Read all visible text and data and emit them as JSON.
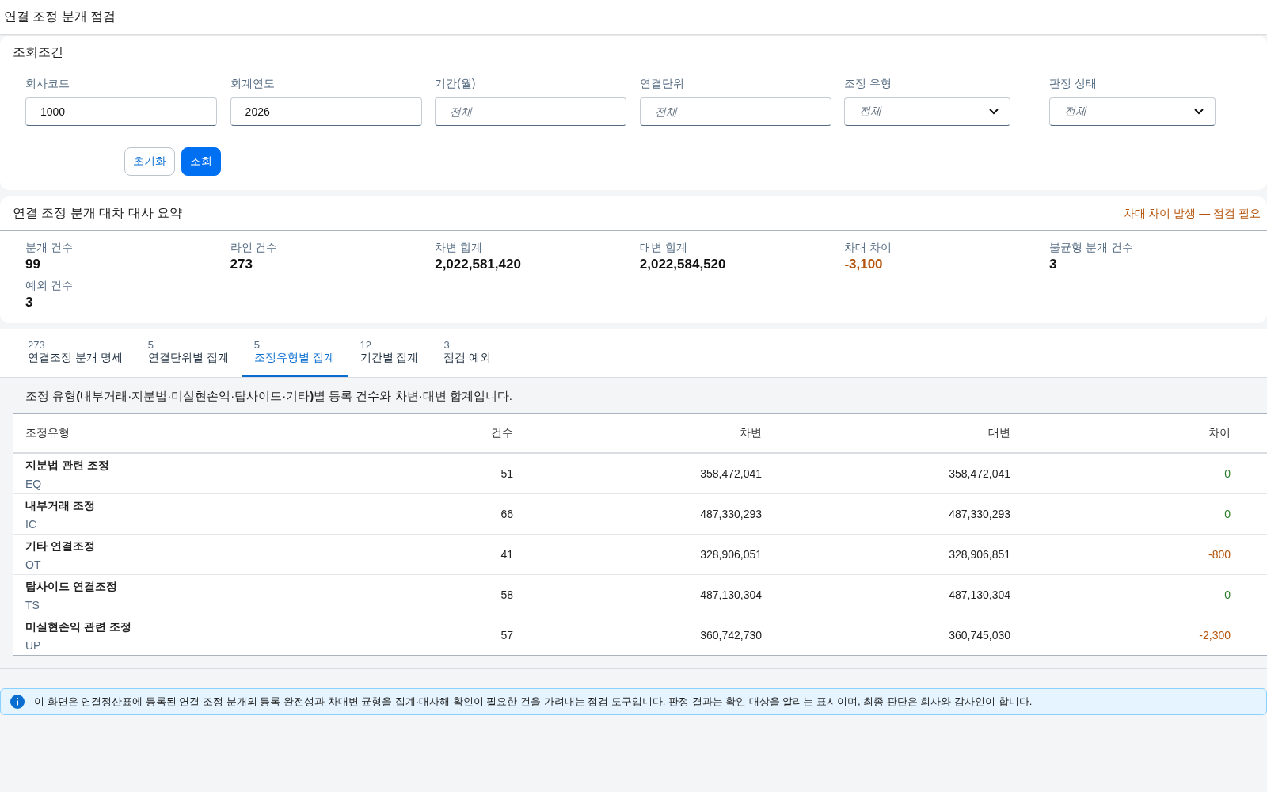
{
  "page_title": "연결 조정 분개 점검",
  "filter": {
    "title": "조회조건",
    "fields": [
      {
        "label": "회사코드",
        "kind": "text",
        "value": "1000"
      },
      {
        "label": "회계연도",
        "kind": "text",
        "value": "2026"
      },
      {
        "label": "기간(월)",
        "kind": "text",
        "placeholder": "전체"
      },
      {
        "label": "연결단위",
        "kind": "text",
        "placeholder": "전체"
      },
      {
        "label": "조정 유형",
        "kind": "select",
        "placeholder": "전체"
      },
      {
        "label": "판정 상태",
        "kind": "select",
        "placeholder": "전체"
      }
    ],
    "buttons": [
      {
        "label": "초기화",
        "kind": "secondary"
      },
      {
        "label": "조회",
        "kind": "primary"
      }
    ]
  },
  "summary": {
    "title": "연결 조정 분개 대차 대사 요약",
    "alert": "차대 차이 발생 — 점검 필요",
    "metrics": [
      {
        "label": "분개 건수",
        "value": "99",
        "warn": false
      },
      {
        "label": "라인 건수",
        "value": "273",
        "warn": false
      },
      {
        "label": "차변 합계",
        "value": "2,022,581,420",
        "warn": false
      },
      {
        "label": "대변 합계",
        "value": "2,022,584,520",
        "warn": false
      },
      {
        "label": "차대 차이",
        "value": "-3,100",
        "warn": true
      },
      {
        "label": "불균형 분개 건수",
        "value": "3",
        "warn": false
      },
      {
        "label": "예외 건수",
        "value": "3",
        "warn": false
      }
    ]
  },
  "tabs": [
    {
      "count": "273",
      "label": "연결조정 분개 명세",
      "selected": false
    },
    {
      "count": "5",
      "label": "연결단위별 집계",
      "selected": false
    },
    {
      "count": "5",
      "label": "조정유형별 집계",
      "selected": true
    },
    {
      "count": "12",
      "label": "기간별 집계",
      "selected": false
    },
    {
      "count": "3",
      "label": "점검 예외",
      "selected": false
    }
  ],
  "description": "조정 유형**(**내부거래·지분법·미실현손익·탑사이드·기타**)**별 등록 건수와 차변·대변 합계입니다.",
  "table": {
    "columns": [
      "조정유형",
      "건수",
      "차변",
      "대변",
      "차이"
    ],
    "rows": [
      {
        "name": "지분법 관련 조정",
        "code": "EQ",
        "count": "51",
        "debit": "358,472,041",
        "credit": "358,472,041",
        "diff": "0",
        "balanced": true
      },
      {
        "name": "내부거래 조정",
        "code": "IC",
        "count": "66",
        "debit": "487,330,293",
        "credit": "487,330,293",
        "diff": "0",
        "balanced": true
      },
      {
        "name": "기타 연결조정",
        "code": "OT",
        "count": "41",
        "debit": "328,906,051",
        "credit": "328,906,851",
        "diff": "-800",
        "balanced": false
      },
      {
        "name": "탑사이드 연결조정",
        "code": "TS",
        "count": "58",
        "debit": "487,130,304",
        "credit": "487,130,304",
        "diff": "0",
        "balanced": true
      },
      {
        "name": "미실현손익 관련 조정",
        "code": "UP",
        "count": "57",
        "debit": "360,742,730",
        "credit": "360,745,030",
        "diff": "-2,300",
        "balanced": false
      }
    ]
  },
  "notice": "이 화면은 연결정산표에 등록된 연결 조정 분개의 등록 완전성과 차대변 균형을 집계·대사해 확인이 필요한 건을 가려내는 점검 도구입니다. 판정 결과는 확인 대상을 알리는 표시이며, 최종 판단은 회사와 감사인이 합니다."
}
